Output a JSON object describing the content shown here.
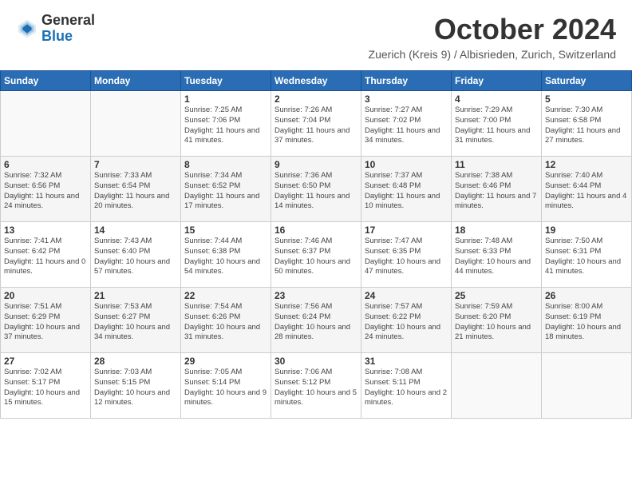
{
  "header": {
    "logo_general": "General",
    "logo_blue": "Blue",
    "month_title": "October 2024",
    "subtitle": "Zuerich (Kreis 9) / Albisrieden, Zurich, Switzerland"
  },
  "weekdays": [
    "Sunday",
    "Monday",
    "Tuesday",
    "Wednesday",
    "Thursday",
    "Friday",
    "Saturday"
  ],
  "weeks": [
    [
      {
        "day": "",
        "sunrise": "",
        "sunset": "",
        "daylight": ""
      },
      {
        "day": "",
        "sunrise": "",
        "sunset": "",
        "daylight": ""
      },
      {
        "day": "1",
        "sunrise": "Sunrise: 7:25 AM",
        "sunset": "Sunset: 7:06 PM",
        "daylight": "Daylight: 11 hours and 41 minutes."
      },
      {
        "day": "2",
        "sunrise": "Sunrise: 7:26 AM",
        "sunset": "Sunset: 7:04 PM",
        "daylight": "Daylight: 11 hours and 37 minutes."
      },
      {
        "day": "3",
        "sunrise": "Sunrise: 7:27 AM",
        "sunset": "Sunset: 7:02 PM",
        "daylight": "Daylight: 11 hours and 34 minutes."
      },
      {
        "day": "4",
        "sunrise": "Sunrise: 7:29 AM",
        "sunset": "Sunset: 7:00 PM",
        "daylight": "Daylight: 11 hours and 31 minutes."
      },
      {
        "day": "5",
        "sunrise": "Sunrise: 7:30 AM",
        "sunset": "Sunset: 6:58 PM",
        "daylight": "Daylight: 11 hours and 27 minutes."
      }
    ],
    [
      {
        "day": "6",
        "sunrise": "Sunrise: 7:32 AM",
        "sunset": "Sunset: 6:56 PM",
        "daylight": "Daylight: 11 hours and 24 minutes."
      },
      {
        "day": "7",
        "sunrise": "Sunrise: 7:33 AM",
        "sunset": "Sunset: 6:54 PM",
        "daylight": "Daylight: 11 hours and 20 minutes."
      },
      {
        "day": "8",
        "sunrise": "Sunrise: 7:34 AM",
        "sunset": "Sunset: 6:52 PM",
        "daylight": "Daylight: 11 hours and 17 minutes."
      },
      {
        "day": "9",
        "sunrise": "Sunrise: 7:36 AM",
        "sunset": "Sunset: 6:50 PM",
        "daylight": "Daylight: 11 hours and 14 minutes."
      },
      {
        "day": "10",
        "sunrise": "Sunrise: 7:37 AM",
        "sunset": "Sunset: 6:48 PM",
        "daylight": "Daylight: 11 hours and 10 minutes."
      },
      {
        "day": "11",
        "sunrise": "Sunrise: 7:38 AM",
        "sunset": "Sunset: 6:46 PM",
        "daylight": "Daylight: 11 hours and 7 minutes."
      },
      {
        "day": "12",
        "sunrise": "Sunrise: 7:40 AM",
        "sunset": "Sunset: 6:44 PM",
        "daylight": "Daylight: 11 hours and 4 minutes."
      }
    ],
    [
      {
        "day": "13",
        "sunrise": "Sunrise: 7:41 AM",
        "sunset": "Sunset: 6:42 PM",
        "daylight": "Daylight: 11 hours and 0 minutes."
      },
      {
        "day": "14",
        "sunrise": "Sunrise: 7:43 AM",
        "sunset": "Sunset: 6:40 PM",
        "daylight": "Daylight: 10 hours and 57 minutes."
      },
      {
        "day": "15",
        "sunrise": "Sunrise: 7:44 AM",
        "sunset": "Sunset: 6:38 PM",
        "daylight": "Daylight: 10 hours and 54 minutes."
      },
      {
        "day": "16",
        "sunrise": "Sunrise: 7:46 AM",
        "sunset": "Sunset: 6:37 PM",
        "daylight": "Daylight: 10 hours and 50 minutes."
      },
      {
        "day": "17",
        "sunrise": "Sunrise: 7:47 AM",
        "sunset": "Sunset: 6:35 PM",
        "daylight": "Daylight: 10 hours and 47 minutes."
      },
      {
        "day": "18",
        "sunrise": "Sunrise: 7:48 AM",
        "sunset": "Sunset: 6:33 PM",
        "daylight": "Daylight: 10 hours and 44 minutes."
      },
      {
        "day": "19",
        "sunrise": "Sunrise: 7:50 AM",
        "sunset": "Sunset: 6:31 PM",
        "daylight": "Daylight: 10 hours and 41 minutes."
      }
    ],
    [
      {
        "day": "20",
        "sunrise": "Sunrise: 7:51 AM",
        "sunset": "Sunset: 6:29 PM",
        "daylight": "Daylight: 10 hours and 37 minutes."
      },
      {
        "day": "21",
        "sunrise": "Sunrise: 7:53 AM",
        "sunset": "Sunset: 6:27 PM",
        "daylight": "Daylight: 10 hours and 34 minutes."
      },
      {
        "day": "22",
        "sunrise": "Sunrise: 7:54 AM",
        "sunset": "Sunset: 6:26 PM",
        "daylight": "Daylight: 10 hours and 31 minutes."
      },
      {
        "day": "23",
        "sunrise": "Sunrise: 7:56 AM",
        "sunset": "Sunset: 6:24 PM",
        "daylight": "Daylight: 10 hours and 28 minutes."
      },
      {
        "day": "24",
        "sunrise": "Sunrise: 7:57 AM",
        "sunset": "Sunset: 6:22 PM",
        "daylight": "Daylight: 10 hours and 24 minutes."
      },
      {
        "day": "25",
        "sunrise": "Sunrise: 7:59 AM",
        "sunset": "Sunset: 6:20 PM",
        "daylight": "Daylight: 10 hours and 21 minutes."
      },
      {
        "day": "26",
        "sunrise": "Sunrise: 8:00 AM",
        "sunset": "Sunset: 6:19 PM",
        "daylight": "Daylight: 10 hours and 18 minutes."
      }
    ],
    [
      {
        "day": "27",
        "sunrise": "Sunrise: 7:02 AM",
        "sunset": "Sunset: 5:17 PM",
        "daylight": "Daylight: 10 hours and 15 minutes."
      },
      {
        "day": "28",
        "sunrise": "Sunrise: 7:03 AM",
        "sunset": "Sunset: 5:15 PM",
        "daylight": "Daylight: 10 hours and 12 minutes."
      },
      {
        "day": "29",
        "sunrise": "Sunrise: 7:05 AM",
        "sunset": "Sunset: 5:14 PM",
        "daylight": "Daylight: 10 hours and 9 minutes."
      },
      {
        "day": "30",
        "sunrise": "Sunrise: 7:06 AM",
        "sunset": "Sunset: 5:12 PM",
        "daylight": "Daylight: 10 hours and 5 minutes."
      },
      {
        "day": "31",
        "sunrise": "Sunrise: 7:08 AM",
        "sunset": "Sunset: 5:11 PM",
        "daylight": "Daylight: 10 hours and 2 minutes."
      },
      {
        "day": "",
        "sunrise": "",
        "sunset": "",
        "daylight": ""
      },
      {
        "day": "",
        "sunrise": "",
        "sunset": "",
        "daylight": ""
      }
    ]
  ]
}
